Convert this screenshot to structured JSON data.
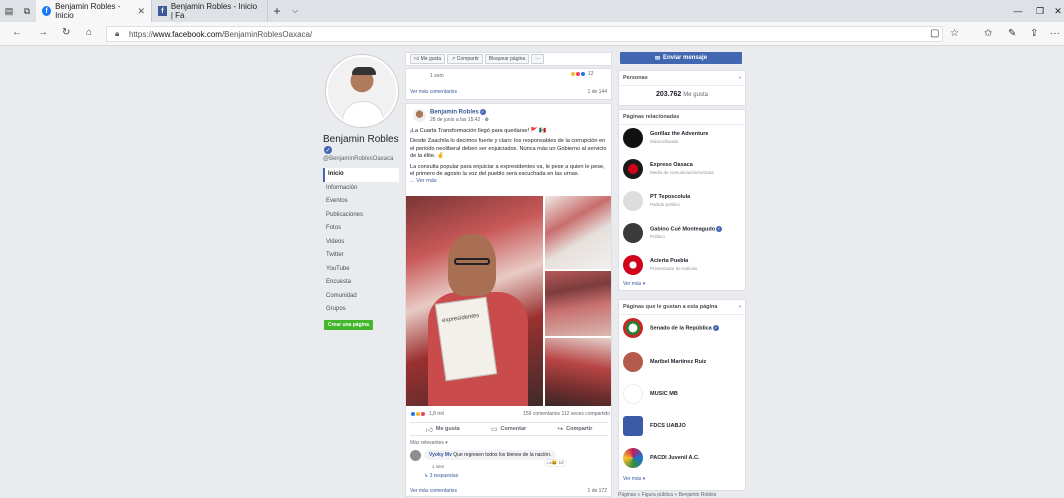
{
  "browser": {
    "tabs": [
      {
        "title": "Benjamin Robles - Inicio",
        "active": true
      },
      {
        "title": "Benjamin Robles - Inicio | Fa",
        "active": false
      }
    ],
    "url_prefix": "https://",
    "url_domain": "www.facebook.com",
    "url_path": "/BenjaminRoblesOaxaca/"
  },
  "profile": {
    "name": "Benjamin Robles",
    "handle": "@BenjaminRoblesOaxaca",
    "nav": [
      "Inicio",
      "Información",
      "Eventos",
      "Publicaciones",
      "Fotos",
      "Videos",
      "Twitter",
      "YouTube",
      "Encuesta",
      "Comunidad",
      "Grupos"
    ],
    "create_page": "Crear una página"
  },
  "actionbar": {
    "like": "Me gusta",
    "share": "Compartir",
    "block": "Bloquear página",
    "more": "···"
  },
  "prev_post": {
    "time": "1 sem",
    "reaction_count": "12",
    "more_comments": "Ver más comentarios",
    "count": "1 de 144"
  },
  "post": {
    "author": "Benjamin Robles",
    "time": "28 de junio a las 15:42 ·",
    "p1": "¡La Cuarta Transformación llegó para quedarse! 🚩 🇲🇽",
    "p2": "Desde Zaachila lo decimos fuerte y claro: los responsables de la corrupción en el periodo neoliberal deben ser enjuiciados. Nunca más un Gobierno al servicio de la élite. ✌",
    "p3": "La consulta popular para enjuiciar a expresidentes va, le pese a quien le pese, el primero de agosto la voz del pueblo será escuchada en las urnas.",
    "see_more": "... Ver más",
    "paper_text": "expresidentes",
    "reaction_count": "1,8 mil",
    "stats": "159 comentarios  112 veces compartido",
    "like": "Me gusta",
    "comment": "Comentar",
    "share": "Compartir",
    "relevant": "Más relevantes ▾",
    "comment_author": "Vyoky Mv",
    "comment_text": "Que regresen todos los bienes de la nación.",
    "comment_reactions": "13",
    "comment_time": "1 sem",
    "replies": "↳ 3 respuestas",
    "more_comments": "Ver más comentarios",
    "more_count": "1 de 172"
  },
  "sidebar": {
    "message": "Enviar mensaje",
    "people_title": "Personas",
    "likes_number": "203.762",
    "likes_label": "Me gusta",
    "related_title": "Páginas relacionadas",
    "related": [
      {
        "name": "Gorillaz the Adventure",
        "sub": "Músico/banda",
        "color": "#111111"
      },
      {
        "name": "Expreso Oaxaca",
        "sub": "Medio de comunicación/noticias",
        "color": "#1a1a1a"
      },
      {
        "name": "PT Teposcolula",
        "sub": "Partido político",
        "color": "#dddddd"
      },
      {
        "name": "Gabino Cué Monteagudo",
        "sub": "Político",
        "color": "#3a3a3a"
      },
      {
        "name": "Acierta Puebla",
        "sub": "Presentador de noticias",
        "color": "#d0021b"
      }
    ],
    "related_more": "Ver más ▾",
    "liked_title": "Páginas que le gustan a esta página",
    "liked": [
      {
        "name": "Senado de la República",
        "color": "#2e7d32"
      },
      {
        "name": "Maribel Martínez Ruiz",
        "color": "#b35a4a"
      },
      {
        "name": "MUSIC MB",
        "color": "#ffffff"
      },
      {
        "name": "FDCS UABJO",
        "color": "#3b5ba8"
      },
      {
        "name": "PACDI Juvenil A.C.",
        "color": "#c2185b"
      }
    ],
    "liked_more": "Ver más ▾",
    "footer": "Páginas » Figura pública » Benjamin Robles"
  }
}
